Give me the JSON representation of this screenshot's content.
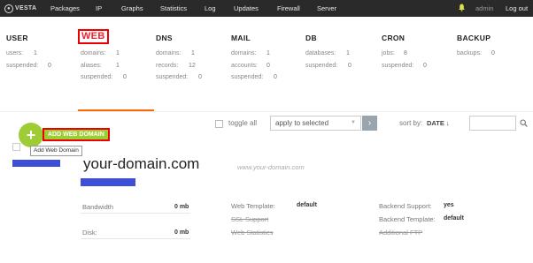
{
  "topnav": {
    "logo": "VESTA",
    "items": [
      {
        "label": "Packages",
        "active": false
      },
      {
        "label": "IP",
        "active": false
      },
      {
        "label": "Graphs",
        "active": false
      },
      {
        "label": "Statistics",
        "active": false
      },
      {
        "label": "Log",
        "active": false
      },
      {
        "label": "Updates",
        "active": false
      },
      {
        "label": "Firewall",
        "active": false
      },
      {
        "label": "Server",
        "active": false
      }
    ],
    "user": "admin",
    "logout": "Log out"
  },
  "stats": {
    "user": {
      "title": "USER",
      "rows": [
        {
          "label": "users:",
          "value": "1"
        },
        {
          "label": "suspended:",
          "value": "0"
        }
      ]
    },
    "web": {
      "title": "WEB",
      "rows": [
        {
          "label": "domains:",
          "value": "1"
        },
        {
          "label": "aliases:",
          "value": "1"
        },
        {
          "label": "suspended:",
          "value": "0"
        }
      ]
    },
    "dns": {
      "title": "DNS",
      "rows": [
        {
          "label": "domains:",
          "value": "1"
        },
        {
          "label": "records:",
          "value": "12"
        },
        {
          "label": "suspended:",
          "value": "0"
        }
      ]
    },
    "mail": {
      "title": "MAIL",
      "rows": [
        {
          "label": "domains:",
          "value": "1"
        },
        {
          "label": "accounts:",
          "value": "0"
        },
        {
          "label": "suspended:",
          "value": "0"
        }
      ]
    },
    "db": {
      "title": "DB",
      "rows": [
        {
          "label": "databases:",
          "value": "1"
        },
        {
          "label": "suspended:",
          "value": "0"
        }
      ]
    },
    "cron": {
      "title": "CRON",
      "rows": [
        {
          "label": "jobs:",
          "value": "8"
        },
        {
          "label": "suspended:",
          "value": "0"
        }
      ]
    },
    "backup": {
      "title": "BACKUP",
      "rows": [
        {
          "label": "backups:",
          "value": "0"
        }
      ]
    }
  },
  "toolbar": {
    "toggle_all": "toggle all",
    "apply_select": "apply to selected",
    "sort_label": "sort by:",
    "sort_value": "DATE ↓",
    "search_placeholder": ""
  },
  "add": {
    "button": "ADD WEB DOMAIN",
    "tooltip": "Add Web Domain"
  },
  "domain": {
    "name": "your-domain.com",
    "alias": "www.your-domain.com",
    "details": {
      "bandwidth_label": "Bandwidth",
      "bandwidth_value": "0 mb",
      "disk_label": "Disk:",
      "disk_value": "0 mb",
      "web_template_label": "Web Template:",
      "web_template_value": "default",
      "ssl_label": "SSL Support",
      "web_stats_label": "Web Statistics",
      "backend_support_label": "Backend Support:",
      "backend_support_value": "yes",
      "backend_template_label": "Backend Template:",
      "backend_template_value": "default",
      "ftp_label": "Additional FTP"
    }
  },
  "colors": {
    "accent": "#ff6701",
    "add_green": "#9dcc34",
    "highlight_red": "#e00000",
    "redacted_blue": "#3c4fd6",
    "nav_bg": "#2a2a2a"
  }
}
